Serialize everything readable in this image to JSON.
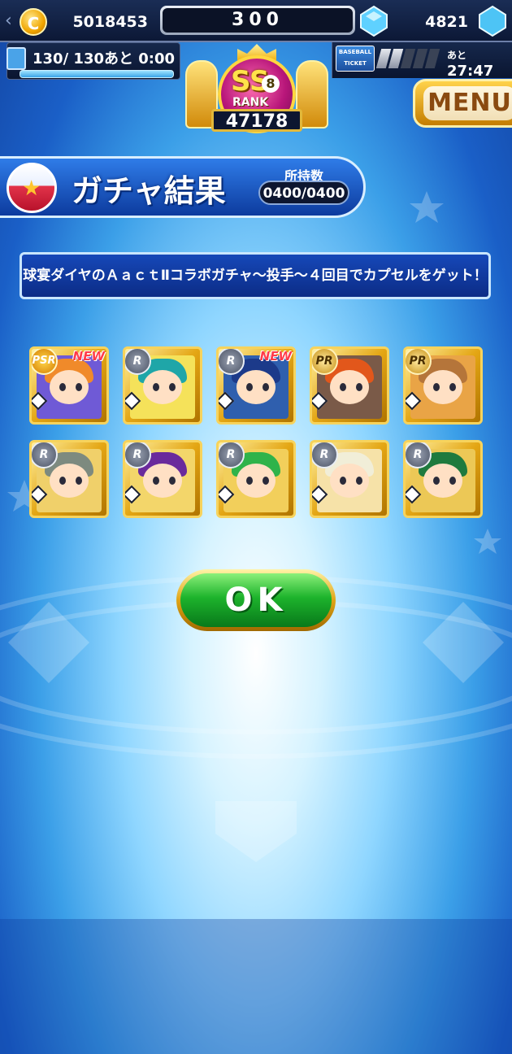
{
  "topbar": {
    "coins": "5018453",
    "center_value": "300",
    "gems": "4821",
    "stamina": "130/ 130",
    "stamina_recover_label": "あと",
    "stamina_recover_time": "0:00",
    "ticket_label_1": "BASEBALL",
    "ticket_label_2": "TICKET",
    "ticket_slots_filled": 2,
    "ticket_slots_total": 5,
    "ticket_timer_label": "あと",
    "ticket_timer": "27:47",
    "coin_icon": "coin-icon",
    "gem_icon": "diamond-gem-icon"
  },
  "rank": {
    "tier": "SS",
    "level": "8",
    "label": "RANK",
    "score": "47178"
  },
  "menu": {
    "label": "MENU"
  },
  "header": {
    "title": "ガチャ結果",
    "owned_label": "所持数",
    "owned_value": "0400/0400"
  },
  "message": "球宴ダイヤのＡａｃｔⅡコラボガチャ～投手～４回目でカプセルをゲット！",
  "cards": [
    {
      "rarity": "PSR",
      "new": "NEW",
      "frame": "gold",
      "hair": "#f08a2a",
      "bg": "#6f5ad6"
    },
    {
      "rarity": "R",
      "new": "",
      "frame": "gold",
      "hair": "#1fa6a8",
      "bg": "#f5e25a"
    },
    {
      "rarity": "R",
      "new": "NEW",
      "frame": "gold",
      "hair": "#1c3a8a",
      "bg": "#2f5fae"
    },
    {
      "rarity": "PR",
      "new": "",
      "frame": "gold",
      "hair": "#e2571b",
      "bg": "#7a5a48"
    },
    {
      "rarity": "PR",
      "new": "",
      "frame": "gold",
      "hair": "#b5753a",
      "bg": "#e9a446"
    },
    {
      "rarity": "R",
      "new": "",
      "frame": "gold",
      "hair": "#7d8a7f",
      "bg": "#f0d06a"
    },
    {
      "rarity": "R",
      "new": "",
      "frame": "gold",
      "hair": "#6a2a9c",
      "bg": "#f3d66a"
    },
    {
      "rarity": "R",
      "new": "",
      "frame": "gold",
      "hair": "#2fb34a",
      "bg": "#f2cf5b"
    },
    {
      "rarity": "R",
      "new": "",
      "frame": "gold",
      "hair": "#f1eed8",
      "bg": "#f6e2a8"
    },
    {
      "rarity": "R",
      "new": "",
      "frame": "gold",
      "hair": "#1f7a3e",
      "bg": "#ecc856"
    }
  ],
  "ok_button": {
    "label": "OK"
  },
  "colors": {
    "accent_blue": "#1648b8",
    "ok_green": "#1db32c",
    "gold": "#e4a614",
    "new_red": "#ff3b4a"
  }
}
